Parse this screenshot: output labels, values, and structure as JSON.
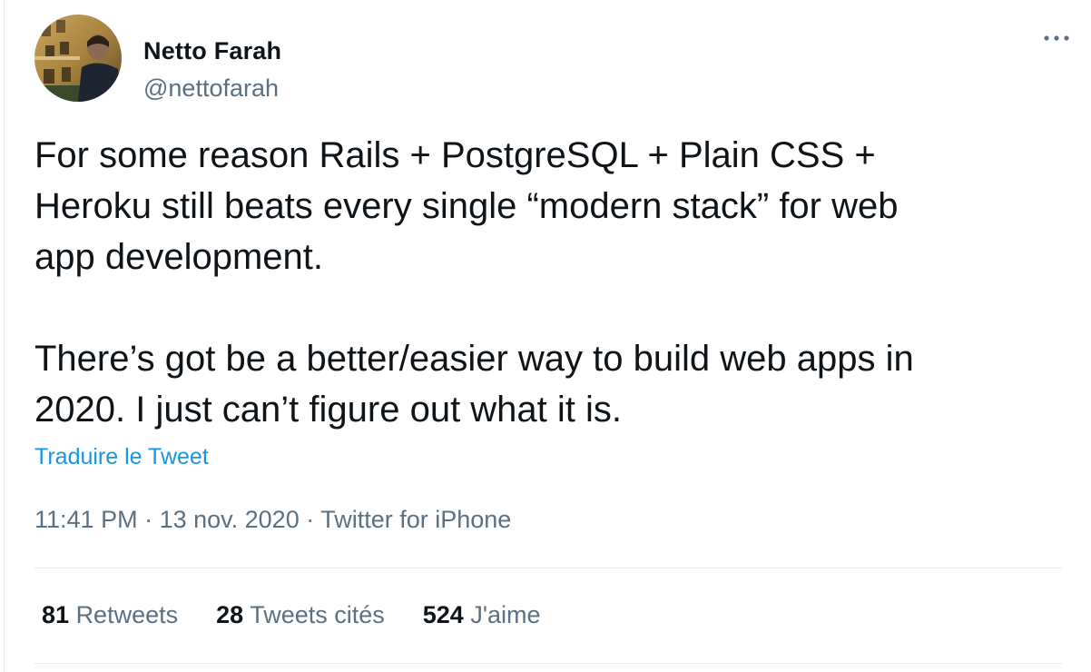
{
  "author": {
    "display_name": "Netto Farah",
    "handle": "@nettofarah"
  },
  "tweet": {
    "text": "For some reason Rails + PostgreSQL + Plain CSS +\nHeroku still beats every single “modern stack” for web\napp development.\n\nThere’s got be a better/easier way to build web apps in\n2020. I just can’t figure out what it is.",
    "translate_label": "Traduire le Tweet",
    "time": "11:41 PM",
    "date": "13 nov. 2020",
    "source": "Twitter for iPhone",
    "separator": " · "
  },
  "stats": {
    "retweets": {
      "count": "81",
      "label": "Retweets"
    },
    "quotes": {
      "count": "28",
      "label": "Tweets cités"
    },
    "likes": {
      "count": "524",
      "label": "J'aime"
    }
  },
  "colors": {
    "text": "#0f1419",
    "secondary": "#5b7083",
    "link": "#1b95e0",
    "divider": "#e6ecf0"
  },
  "icons": {
    "more": "more-horizontal-icon",
    "avatar": "profile-photo"
  }
}
